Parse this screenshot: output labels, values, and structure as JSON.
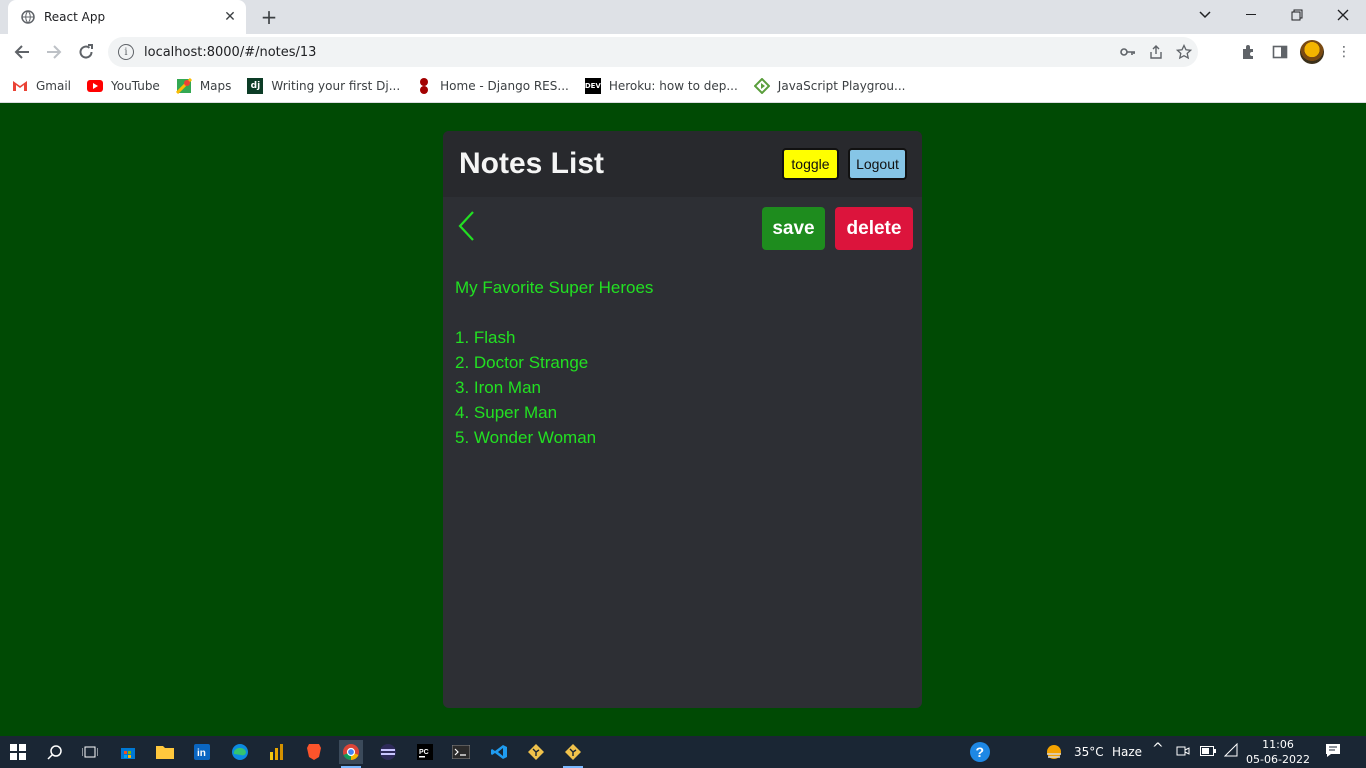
{
  "browser": {
    "tab_title": "React App",
    "url": "localhost:8000/#/notes/13",
    "bookmarks": [
      {
        "label": "Gmail",
        "icon": "gmail-icon"
      },
      {
        "label": "YouTube",
        "icon": "youtube-icon"
      },
      {
        "label": "Maps",
        "icon": "maps-icon"
      },
      {
        "label": "Writing your first Dj...",
        "icon": "django-icon"
      },
      {
        "label": "Home - Django RES...",
        "icon": "drf-icon"
      },
      {
        "label": "Heroku: how to dep...",
        "icon": "dev-icon"
      },
      {
        "label": "JavaScript Playgrou...",
        "icon": "playground-icon"
      }
    ]
  },
  "app": {
    "title": "Notes List",
    "toggle_label": "toggle",
    "logout_label": "Logout",
    "save_label": "save",
    "delete_label": "delete",
    "note_lines": [
      "My Favorite Super Heroes",
      "",
      "1. Flash",
      "2. Doctor Strange",
      "3. Iron Man",
      "4. Super Man",
      "5. Wonder Woman"
    ]
  },
  "taskbar": {
    "temperature": "35°C",
    "weather": "Haze",
    "time": "11:06",
    "date": "05-06-2022"
  },
  "colors": {
    "page_bg": "#004a04",
    "card_bg": "#2d2f34",
    "note_text": "#22e022",
    "toggle_bg": "#ffff00",
    "logout_bg": "#86c5e6",
    "save_bg": "#1e8c1e",
    "delete_bg": "#dc143c"
  }
}
